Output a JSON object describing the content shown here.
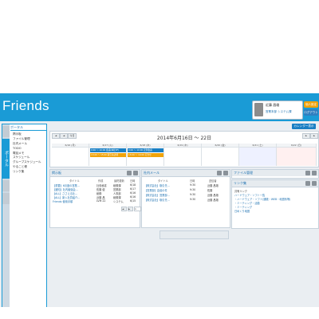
{
  "app": {
    "title": "Friends"
  },
  "user": {
    "name": "近藤 昌雄",
    "sub": "営業本部 システム課"
  },
  "header_buttons": {
    "personal_settings": "個人設定",
    "logout": "ログアウト"
  },
  "sidebar": {
    "tab_portal": "ポータル",
    "menu_title": "ポータル",
    "items": [
      "掲示板",
      "ファイル管理",
      "社内メール",
      "TODO",
      "電話メモ",
      "スケジュール",
      "グループスケジュール",
      "やること帳",
      "リンク集"
    ]
  },
  "calendar": {
    "move_button": "カレンダー表示",
    "range": "2014年6月16日 ～ 22日",
    "prev": "◄",
    "prev2": "◄",
    "today": "今日",
    "next": "►",
    "next2": "►",
    "days": [
      "6/16 (月)",
      "6/17 (火)",
      "6/18 (水)",
      "6/19 (木)",
      "6/20 (金)",
      "6/21 (土)",
      "6/22 (日)"
    ],
    "events": [
      {
        "label": "9:00 〜 10:00 会議(本社3F)",
        "color": "#1a7fc4"
      },
      {
        "label": "13:00 〜 15:00 取引先訪問",
        "color": "#f0a30a"
      },
      {
        "label": "9:00 〜 10:00 定例会議",
        "color": "#1a7fc4"
      },
      {
        "label": "13:00 〜 14:00 打合せ",
        "color": "#f0a30a"
      }
    ]
  },
  "board": {
    "title": "掲示板",
    "columns": [
      "タイトル",
      "作成",
      "最終更新",
      "日時"
    ],
    "rows": [
      [
        "【重要】6月度の営業...",
        "社長秘書",
        "総務課",
        "6/18"
      ],
      [
        "【通知】社内勉強会...",
        "佐藤 健",
        "営業部",
        "6/17"
      ],
      [
        "【ALL】ささえる社...",
        "総務",
        "人事部",
        "6/16"
      ],
      [
        "【ALL】新入社員紹介...",
        "近藤 昌",
        "総務課",
        "6/16"
      ],
      [
        "Friends 使用手順",
        "LVM 22",
        "システム",
        "6/15"
      ]
    ],
    "pager_prev": "◄",
    "pager_next": "►",
    "pager_value": "1"
  },
  "mail": {
    "title": "社内メール",
    "columns": [
      "タイトル",
      "日時",
      "送信者"
    ],
    "rows": [
      [
        "【株式会社】取引先...",
        "9:30",
        "近藤 昌雄"
      ],
      [
        "【営業部】会議の件",
        "9:30",
        "佐藤"
      ],
      [
        "【株式会社】営業部...",
        "9:30",
        "近藤 昌雄"
      ],
      [
        "【株式会社】取引先...",
        "9:30",
        "近藤 昌雄"
      ]
    ]
  },
  "files": {
    "title": "ファイル管理"
  },
  "links": {
    "title": "リンク集",
    "subtitle": "共有リンク",
    "items": [
      "ハードウェア・ソフト一覧",
      "・ハードウェア・ソフト(通販・WEB・地図系等)",
      "・ミーティング・活動",
      "・ミーティング",
      "日めくり地図"
    ]
  }
}
